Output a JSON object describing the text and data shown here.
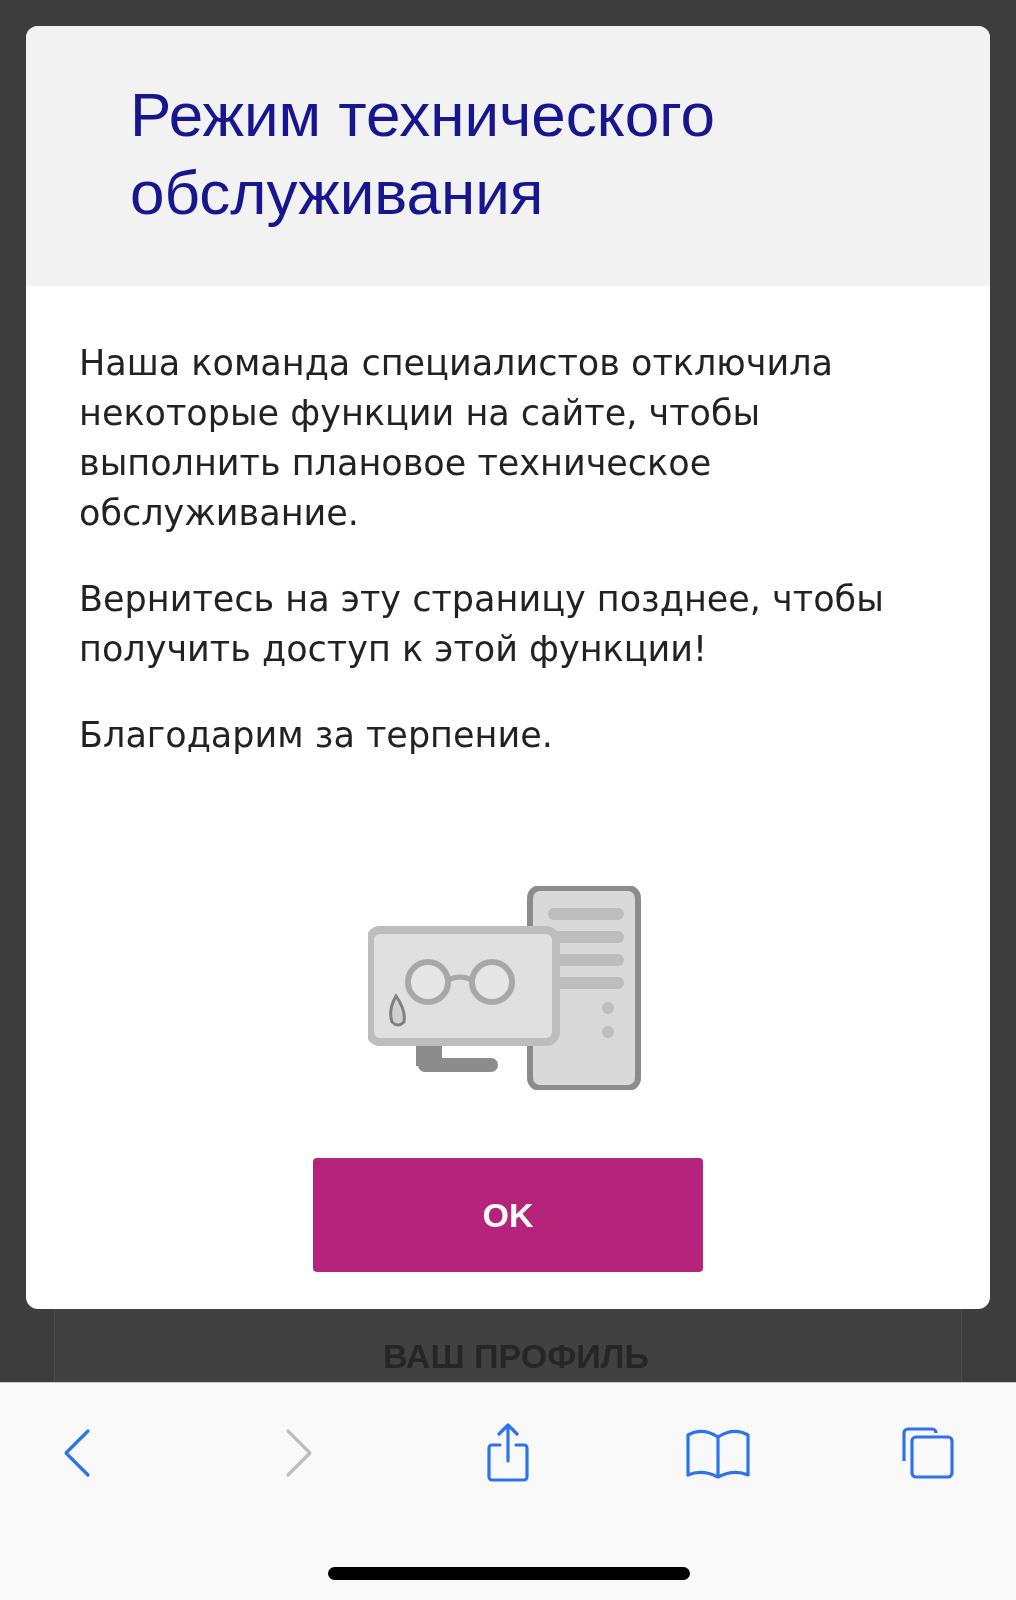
{
  "background": {
    "section_title": "ВАШ ПРОФИЛЬ"
  },
  "dialog": {
    "title": "Режим технического обслуживания",
    "paragraphs": [
      "Наша команда специалистов отключила некоторые функции на сайте, чтобы выполнить плановое техническое обслуживание.",
      "Вернитесь на эту страницу позднее, чтобы получить доступ к этой функции!",
      "Благодарим за терпение."
    ],
    "button": "OK"
  },
  "toolbar": [
    {
      "kind": "back",
      "disabled": false
    },
    {
      "kind": "forward",
      "disabled": true
    },
    {
      "kind": "share",
      "disabled": false
    },
    {
      "kind": "bookmarks",
      "disabled": false
    },
    {
      "kind": "tabs",
      "disabled": false
    }
  ]
}
